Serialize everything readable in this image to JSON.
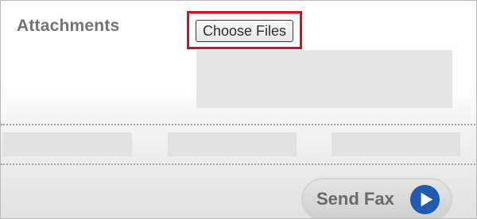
{
  "attachments": {
    "label": "Attachments",
    "choose_files_label": "Choose Files",
    "highlight_color": "#d4111b"
  },
  "actions": {
    "send_fax_label": "Send Fax",
    "send_icon": "play-circle-icon",
    "send_icon_color": "#1f5bb0"
  }
}
